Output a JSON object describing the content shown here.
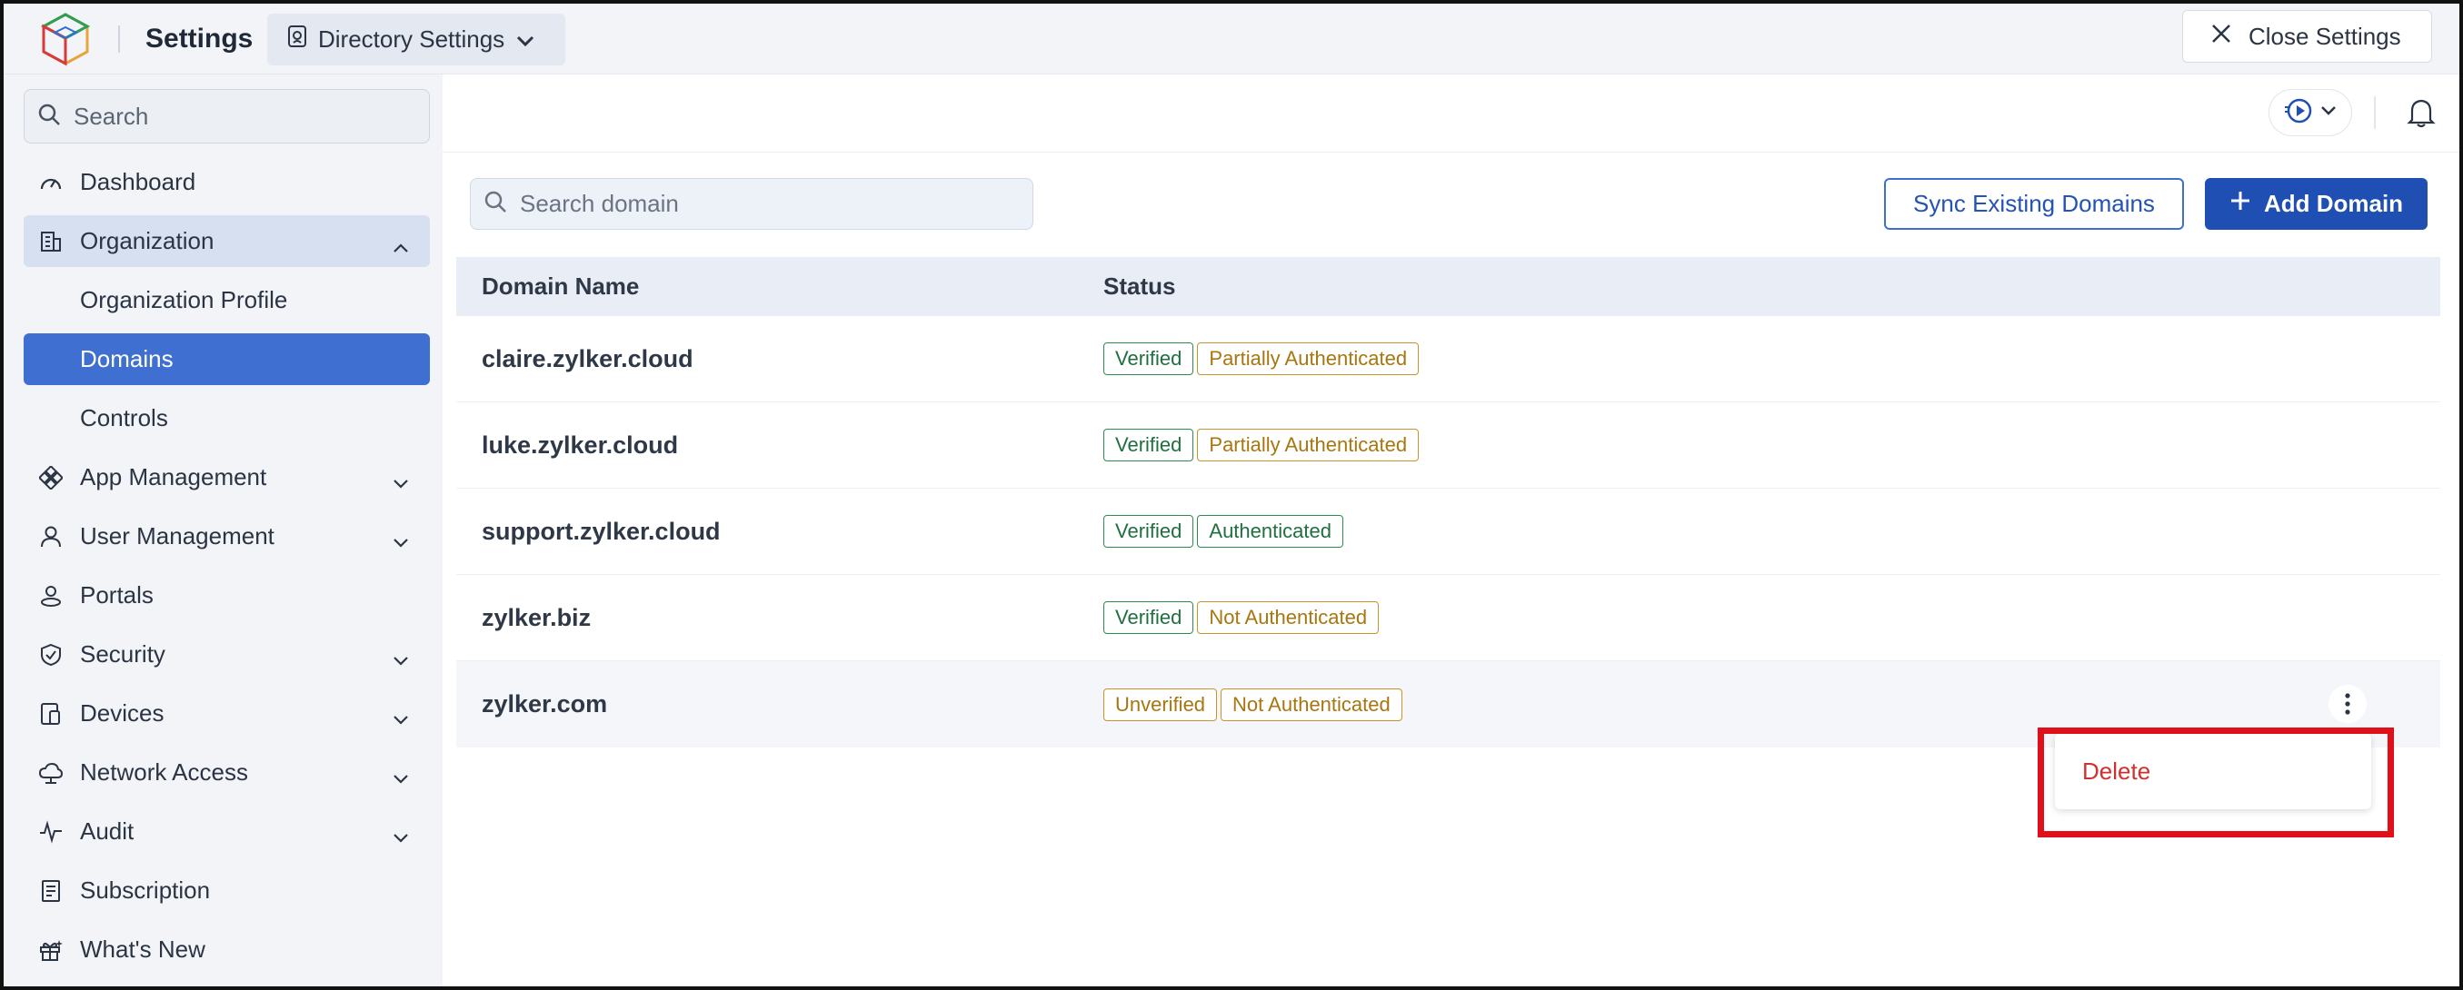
{
  "header": {
    "app_title": "Settings",
    "directory_button": "Directory Settings",
    "close_button": "Close Settings"
  },
  "sidebar": {
    "search_placeholder": "Search",
    "items": [
      {
        "label": "Dashboard",
        "icon": "dashboard-icon"
      },
      {
        "label": "Organization",
        "icon": "organization-icon",
        "expanded": true
      },
      {
        "label": "Organization Profile",
        "sub": true
      },
      {
        "label": "Domains",
        "sub": true,
        "active": true
      },
      {
        "label": "Controls",
        "sub": true
      },
      {
        "label": "App Management",
        "icon": "app-management-icon",
        "chevron": true
      },
      {
        "label": "User Management",
        "icon": "user-icon",
        "chevron": true
      },
      {
        "label": "Portals",
        "icon": "portal-icon"
      },
      {
        "label": "Security",
        "icon": "shield-icon",
        "chevron": true
      },
      {
        "label": "Devices",
        "icon": "devices-icon",
        "chevron": true
      },
      {
        "label": "Network Access",
        "icon": "cloud-icon",
        "chevron": true
      },
      {
        "label": "Audit",
        "icon": "pulse-icon",
        "chevron": true
      },
      {
        "label": "Subscription",
        "icon": "receipt-icon"
      },
      {
        "label": "What's New",
        "icon": "gift-icon"
      }
    ]
  },
  "toolbar": {
    "domain_search_placeholder": "Search domain",
    "sync_button": "Sync Existing Domains",
    "add_button": "Add Domain"
  },
  "table": {
    "headers": [
      "Domain Name",
      "Status"
    ],
    "rows": [
      {
        "domain": "claire.zylker.cloud",
        "badges": [
          {
            "text": "Verified",
            "tone": "green"
          },
          {
            "text": "Partially Authenticated",
            "tone": "orange"
          }
        ]
      },
      {
        "domain": "luke.zylker.cloud",
        "badges": [
          {
            "text": "Verified",
            "tone": "green"
          },
          {
            "text": "Partially Authenticated",
            "tone": "orange"
          }
        ]
      },
      {
        "domain": "support.zylker.cloud",
        "badges": [
          {
            "text": "Verified",
            "tone": "green"
          },
          {
            "text": "Authenticated",
            "tone": "green"
          }
        ]
      },
      {
        "domain": "zylker.biz",
        "badges": [
          {
            "text": "Verified",
            "tone": "green"
          },
          {
            "text": "Not Authenticated",
            "tone": "orange"
          }
        ]
      },
      {
        "domain": "zylker.com",
        "badges": [
          {
            "text": "Unverified",
            "tone": "orange"
          },
          {
            "text": "Not Authenticated",
            "tone": "orange"
          }
        ],
        "highlighted": true
      }
    ]
  },
  "context_menu": {
    "delete_label": "Delete"
  },
  "colors": {
    "accent": "#3f6fd1",
    "primary_button": "#1f4fb3",
    "verified_green": "#2f8a52",
    "warning_orange": "#c99325",
    "delete_red": "#d42f2f",
    "highlight_red": "#e0101a"
  }
}
